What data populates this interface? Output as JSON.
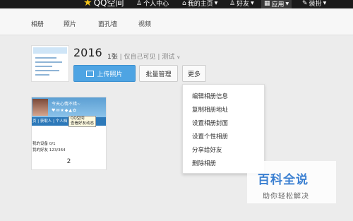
{
  "topbar": {
    "logo": "QQ空间",
    "items": [
      {
        "label": "个人中心"
      },
      {
        "label": "我的主页"
      },
      {
        "label": "好友"
      },
      {
        "label": "应用"
      },
      {
        "label": "装扮"
      }
    ]
  },
  "subnav": {
    "tabs": [
      "相册",
      "照片",
      "面孔墙",
      "视频"
    ]
  },
  "album": {
    "title": "2016",
    "count": "1张",
    "separator": "|",
    "privacy": "仅自己可见",
    "separator2": "|",
    "category": "测试"
  },
  "buttons": {
    "upload": "上传照片",
    "batch": "批量管理",
    "more": "更多"
  },
  "dropdown": {
    "items": [
      "编辑相册信息",
      "复制相册地址",
      "设置相册封面",
      "设置个性相册",
      "分享给好友",
      "删除相册"
    ]
  },
  "photo": {
    "thumb_text": "今天心情不错~",
    "thumb_bar": "页 | 获取人 | 个人档",
    "thumb_bar_right": "业",
    "tooltip_line1": "QQ空间",
    "tooltip_line2": "查看好友动态",
    "line1": "我的设备 0/1",
    "line2": "我的好友 123/364",
    "number": "2"
  },
  "watermark": {
    "title": "百科全说",
    "subtitle": "助你轻松解决"
  },
  "colors": {
    "accent": "#4ea4e3",
    "topbar": "#1b1b1b",
    "watermark": "#3a7fd1"
  }
}
